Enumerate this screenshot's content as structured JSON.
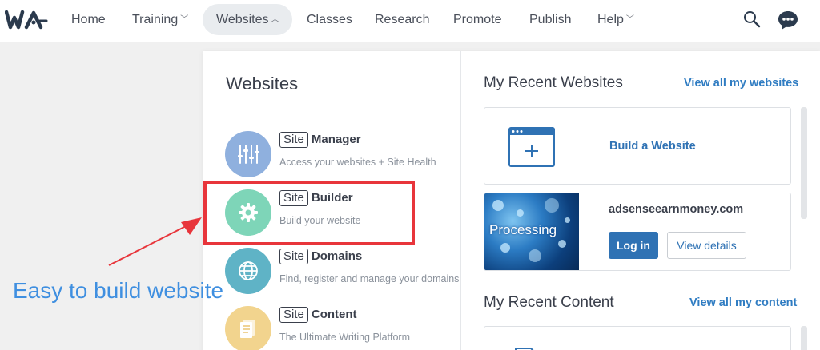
{
  "nav": {
    "items": [
      {
        "label": "Home"
      },
      {
        "label": "Training"
      },
      {
        "label": "Websites"
      },
      {
        "label": "Classes"
      },
      {
        "label": "Research"
      },
      {
        "label": "Promote"
      },
      {
        "label": "Publish"
      },
      {
        "label": "Help"
      }
    ],
    "chevron": "⌄",
    "chevron_up": "^"
  },
  "menu": {
    "title": "Websites",
    "site_tag": "Site",
    "entries": [
      {
        "name": "Manager",
        "desc": "Access your websites + Site Health",
        "icon": "sliders-icon",
        "color": "#8fb0de"
      },
      {
        "name": "Builder",
        "desc": "Build your website",
        "icon": "gear-icon",
        "color": "#7ed5b8"
      },
      {
        "name": "Domains",
        "desc": "Find, register and manage your domains",
        "icon": "globe-icon",
        "color": "#5fb3c6"
      },
      {
        "name": "Content",
        "desc": "The Ultimate Writing Platform",
        "icon": "document-icon",
        "color": "#f2d48e"
      }
    ]
  },
  "recent_websites": {
    "title": "My Recent Websites",
    "view_all": "View all my websites",
    "build_label": "Build a Website",
    "site": {
      "domain": "adsenseearnmoney.com",
      "thumb_text": "Processing",
      "login": "Log in",
      "details": "View details"
    }
  },
  "recent_content": {
    "title": "My Recent Content",
    "view_all": "View all my content"
  },
  "annotation": {
    "text": "Easy to build website"
  },
  "colors": {
    "link": "#2f7cc2",
    "annotation_red": "#e8353b",
    "annotation_blue": "#3f8fe0"
  }
}
